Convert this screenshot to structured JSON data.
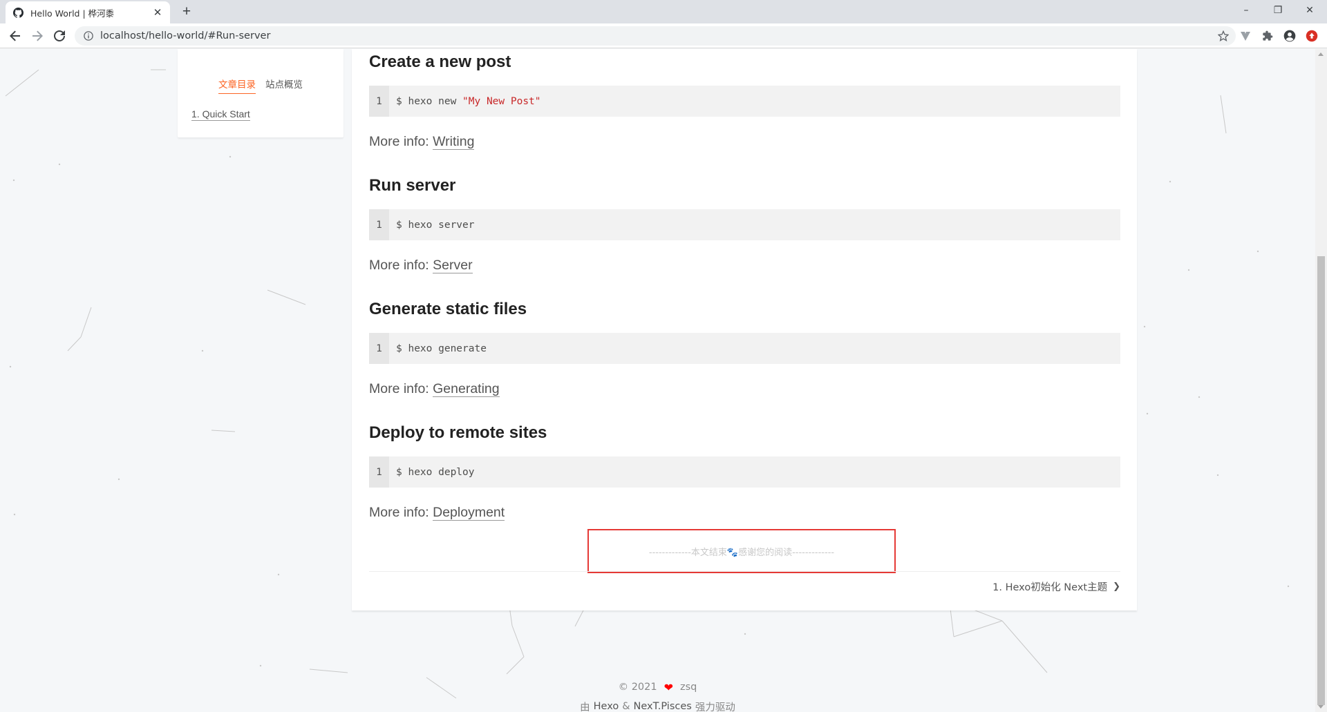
{
  "browser": {
    "tab_title": "Hello World | 桦河黍",
    "url": "localhost/hello-world/#Run-server",
    "window_controls": {
      "minimize": "–",
      "restore": "❐",
      "close": "✕"
    }
  },
  "sidebar": {
    "tabs": [
      {
        "label": "文章目录",
        "active": true
      },
      {
        "label": "站点概览",
        "active": false
      }
    ],
    "toc": [
      {
        "label": "1. Quick Start"
      }
    ]
  },
  "post": {
    "sections": [
      {
        "heading": "Create a new post",
        "line_no": "1",
        "cmd": "$ hexo new ",
        "cmd_str": "\"My New Post\"",
        "more_label": "More info:",
        "more_link": "Writing"
      },
      {
        "heading": "Run server",
        "line_no": "1",
        "cmd": "$ hexo server",
        "more_label": "More info:",
        "more_link": "Server"
      },
      {
        "heading": "Generate static files",
        "line_no": "1",
        "cmd": "$ hexo generate",
        "more_label": "More info:",
        "more_link": "Generating"
      },
      {
        "heading": "Deploy to remote sites",
        "line_no": "1",
        "cmd": "$ hexo deploy",
        "more_label": "More info:",
        "more_link": "Deployment"
      }
    ],
    "end_text": "-------------本文结束🐾感谢您的阅读-------------",
    "next_post": "1. Hexo初始化 Next主题"
  },
  "footer": {
    "copyright": "© 2021",
    "author": "zsq",
    "powered_prefix": "由",
    "hexo_link": "Hexo",
    "amp": "&",
    "theme_link": "NexT.Pisces",
    "powered_suffix": "强力驱动"
  },
  "colors": {
    "accent": "#fc6423",
    "highlight_box": "#e53935",
    "heart": "#ff0000"
  }
}
